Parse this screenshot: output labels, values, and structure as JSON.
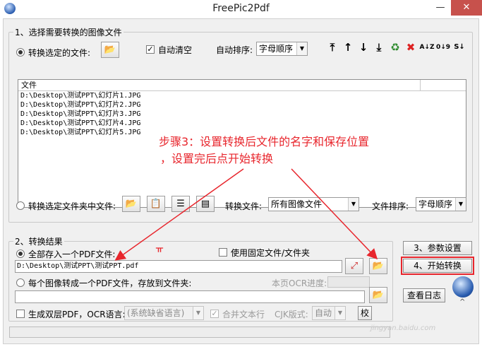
{
  "window": {
    "title": "FreePic2Pdf",
    "minimize": "—",
    "close": "✕"
  },
  "group1": {
    "legend": "1、选择需要转换的图像文件",
    "radio_selected_files": "转换选定的文件:",
    "auto_clear": "自动清空",
    "auto_sort_label": "自动排序:",
    "auto_sort_value": "字母顺序",
    "list_header": "文件",
    "files": [
      "D:\\Desktop\\测试PPT\\幻灯片1.JPG",
      "D:\\Desktop\\测试PPT\\幻灯片2.JPG",
      "D:\\Desktop\\测试PPT\\幻灯片3.JPG",
      "D:\\Desktop\\测试PPT\\幻灯片4.JPG",
      "D:\\Desktop\\测试PPT\\幻灯片5.JPG"
    ],
    "radio_folder": "转换选定文件夹中文件:",
    "convert_files_label": "转换文件:",
    "convert_files_value": "所有图像文件",
    "file_sort_label": "文件排序:",
    "file_sort_value": "字母顺序"
  },
  "group2": {
    "legend": "2、转换结果",
    "radio_single_pdf": "全部存入一个PDF文件:",
    "fixed_file": "使用固定文件/文件夹",
    "output_path": "D:\\Desktop\\测试PPT\\测试PPT.pdf",
    "radio_each_pdf": "每个图像转成一个PDF文件，存放到文件夹:",
    "ocr_progress": "本页OCR进度:",
    "dual_layer": "生成双层PDF，OCR语言:",
    "ocr_language": "(系统缺省语言)",
    "merge_lines": "合并文本行",
    "cjk_label": "CJK版式:",
    "cjk_value": "自动",
    "check_btn": "校"
  },
  "buttons": {
    "params": "3、参数设置",
    "start": "4、开始转换",
    "log": "查看日志"
  },
  "annotation": {
    "line1": "步骤3：设置转换后文件的名字和保存位置",
    "line2": "，设置完后点开始转换"
  },
  "watermark": "jingyan.baidu.com",
  "icons": {
    "folder": "📂",
    "pdf": "⤢",
    "tools": [
      "⤒",
      "↑",
      "↓",
      "⤓",
      "♻",
      "✖",
      "A↓Z",
      "0↓9",
      "S↓"
    ]
  },
  "colors": {
    "annotation": "#e8262d"
  }
}
